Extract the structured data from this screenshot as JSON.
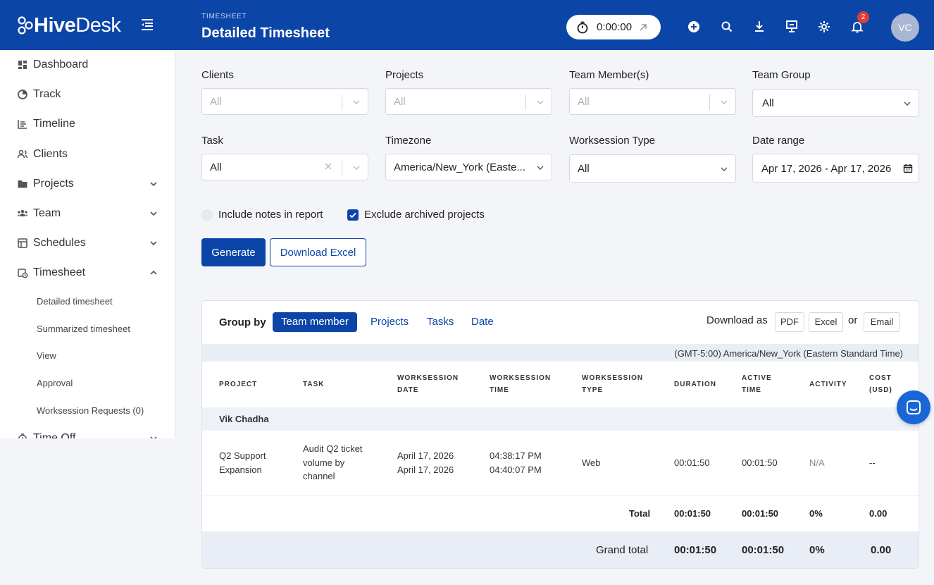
{
  "header": {
    "brand_bold": "Hive",
    "brand_light": "Desk",
    "breadcrumb": "TIMESHEET",
    "title": "Detailed Timesheet",
    "timer_value": "0:00:00",
    "notification_count": "2",
    "avatar_initials": "VC",
    "icons": [
      "timer-icon",
      "external-arrow-icon",
      "add-circle-icon",
      "search-icon",
      "download-icon",
      "presentation-icon",
      "gear-icon",
      "bell-icon"
    ],
    "colors": {
      "primary": "#0b45a8",
      "badge": "#e03b3b"
    }
  },
  "sidebar": {
    "items": [
      {
        "label": "Dashboard",
        "icon": "dashboard-icon"
      },
      {
        "label": "Track",
        "icon": "track-icon"
      },
      {
        "label": "Timeline",
        "icon": "timeline-icon"
      },
      {
        "label": "Clients",
        "icon": "clients-icon"
      },
      {
        "label": "Projects",
        "icon": "folder-icon",
        "chevron": "down"
      },
      {
        "label": "Team",
        "icon": "team-icon",
        "chevron": "down"
      },
      {
        "label": "Schedules",
        "icon": "schedules-icon",
        "chevron": "down"
      },
      {
        "label": "Timesheet",
        "icon": "timesheet-icon",
        "chevron": "up"
      },
      {
        "label": "Time Off",
        "icon": "time-off-icon",
        "chevron": "down"
      }
    ],
    "timesheet_sub": [
      "Detailed timesheet",
      "Summarized timesheet",
      "View",
      "Approval",
      "Worksession Requests (0)"
    ]
  },
  "filters": {
    "clients": {
      "label": "Clients",
      "value": "All"
    },
    "projects": {
      "label": "Projects",
      "value": "All"
    },
    "team_members": {
      "label": "Team Member(s)",
      "value": "All"
    },
    "team_group": {
      "label": "Team Group",
      "value": "All"
    },
    "task": {
      "label": "Task",
      "value": "All"
    },
    "timezone": {
      "label": "Timezone",
      "value": "America/New_York (Easte..."
    },
    "worksession_type": {
      "label": "Worksession Type",
      "value": "All"
    },
    "date_range": {
      "label": "Date range",
      "value": "Apr 17, 2026 - Apr 17, 2026"
    },
    "include_notes": {
      "label": "Include notes in report",
      "checked": false
    },
    "exclude_archived": {
      "label": "Exclude archived projects",
      "checked": true
    },
    "generate_label": "Generate",
    "download_excel_label": "Download Excel"
  },
  "report": {
    "group_by_label": "Group by",
    "group_by_options": [
      "Team member",
      "Projects",
      "Tasks",
      "Date"
    ],
    "group_by_selected": "Team member",
    "download_as_label": "Download as",
    "download_options": [
      "PDF",
      "Excel",
      "Email"
    ],
    "download_or": "or",
    "timezone_note": "(GMT-5:00) America/New_York (Eastern Standard Time)",
    "columns": [
      [
        "PROJECT"
      ],
      [
        "TASK"
      ],
      [
        "WORKSESSION",
        "DATE"
      ],
      [
        "WORKSESSION",
        "TIME"
      ],
      [
        "WORKSESSION",
        "TYPE"
      ],
      [
        "DURATION"
      ],
      [
        "ACTIVE",
        "TIME"
      ],
      [
        "ACTIVITY"
      ],
      [
        "COST",
        "(USD)"
      ]
    ],
    "group_name": "Vik Chadha",
    "rows": [
      {
        "project": [
          "Q2 Support",
          "Expansion"
        ],
        "task": [
          "Audit Q2 ticket",
          "volume by",
          "channel"
        ],
        "date": [
          "April 17, 2026",
          "April 17, 2026"
        ],
        "time": [
          "04:38:17 PM",
          "04:40:07 PM"
        ],
        "type": "Web",
        "duration": "00:01:50",
        "active_time": "00:01:50",
        "activity": "N/A",
        "cost": "--"
      }
    ],
    "total": {
      "label": "Total",
      "duration": "00:01:50",
      "active_time": "00:01:50",
      "activity": "0%",
      "cost": "0.00"
    },
    "grand_total": {
      "label": "Grand total",
      "duration": "00:01:50",
      "active_time": "00:01:50",
      "activity": "0%",
      "cost": "0.00"
    }
  }
}
